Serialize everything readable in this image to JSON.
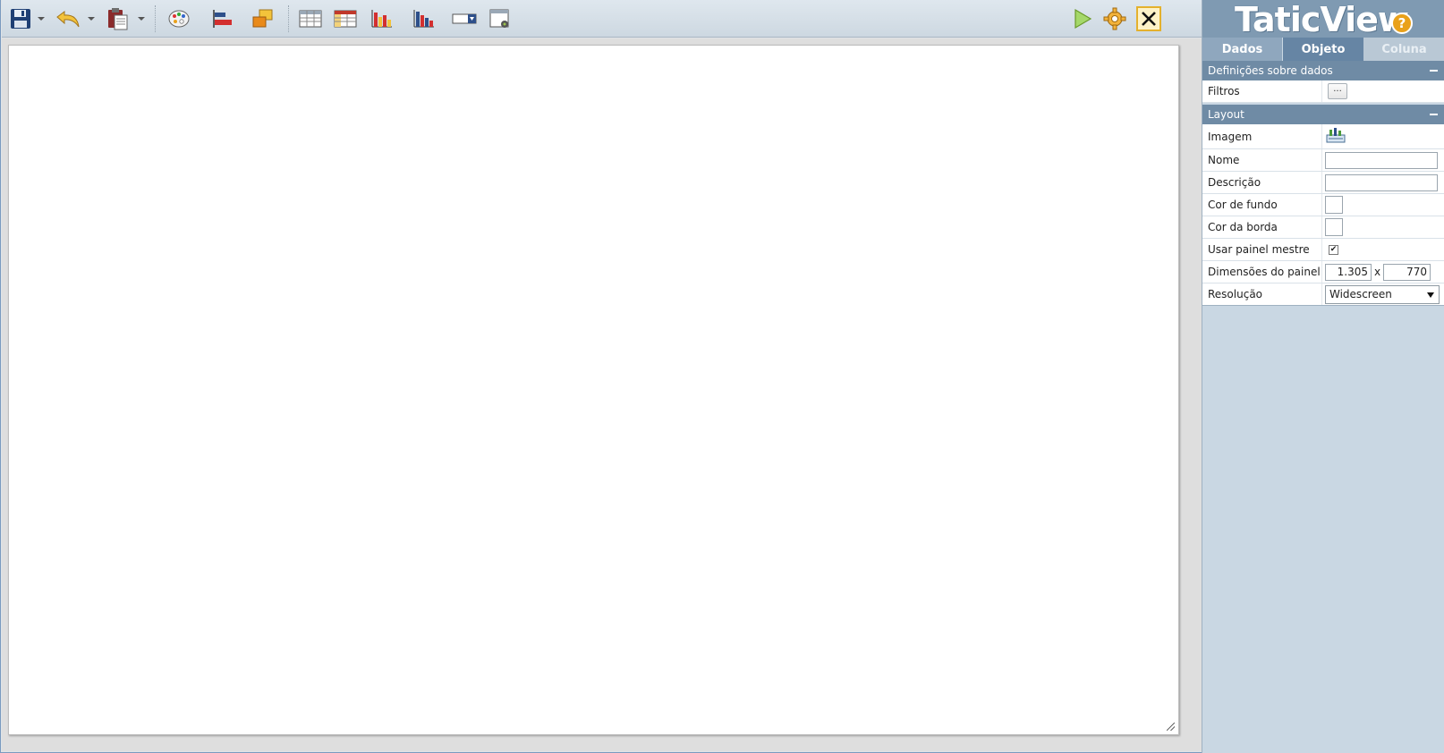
{
  "toolbar": {
    "icons": [
      "save-icon",
      "undo-icon",
      "paste-icon",
      "palette-icon",
      "align-icon",
      "arrange-icon",
      "table-icon",
      "crosstab-icon",
      "bar-chart-icon",
      "column-chart-icon",
      "dropdown-filter-icon",
      "panel-settings-icon",
      "play-icon",
      "gear-icon",
      "close-icon"
    ]
  },
  "brand": {
    "logo_text": "TaticView",
    "help_symbol": "?"
  },
  "tabs": [
    {
      "label": "Dados"
    },
    {
      "label": "Objeto"
    },
    {
      "label": "Coluna"
    }
  ],
  "sections": {
    "data_definitions": {
      "title": "Definições sobre dados"
    },
    "layout": {
      "title": "Layout"
    }
  },
  "properties": {
    "filtros": {
      "label": "Filtros",
      "button": "..."
    },
    "imagem": {
      "label": "Imagem"
    },
    "nome": {
      "label": "Nome",
      "value": ""
    },
    "descricao": {
      "label": "Descrição",
      "value": ""
    },
    "cor_fundo": {
      "label": "Cor de fundo"
    },
    "cor_borda": {
      "label": "Cor da borda"
    },
    "usar_painel": {
      "label": "Usar painel mestre",
      "checked": true,
      "check_glyph": "✔"
    },
    "dimensoes": {
      "label": "Dimensões do painel",
      "width": "1.305",
      "separator": "x",
      "height": "770"
    },
    "resolucao": {
      "label": "Resolução",
      "value": "Widescreen"
    }
  },
  "colors": {
    "panel_header": "#6f8ba5",
    "active_tab": "#6685a4",
    "play": "#8bc34a",
    "gear": "#e9a11a",
    "close_highlight": "#f0c040"
  }
}
